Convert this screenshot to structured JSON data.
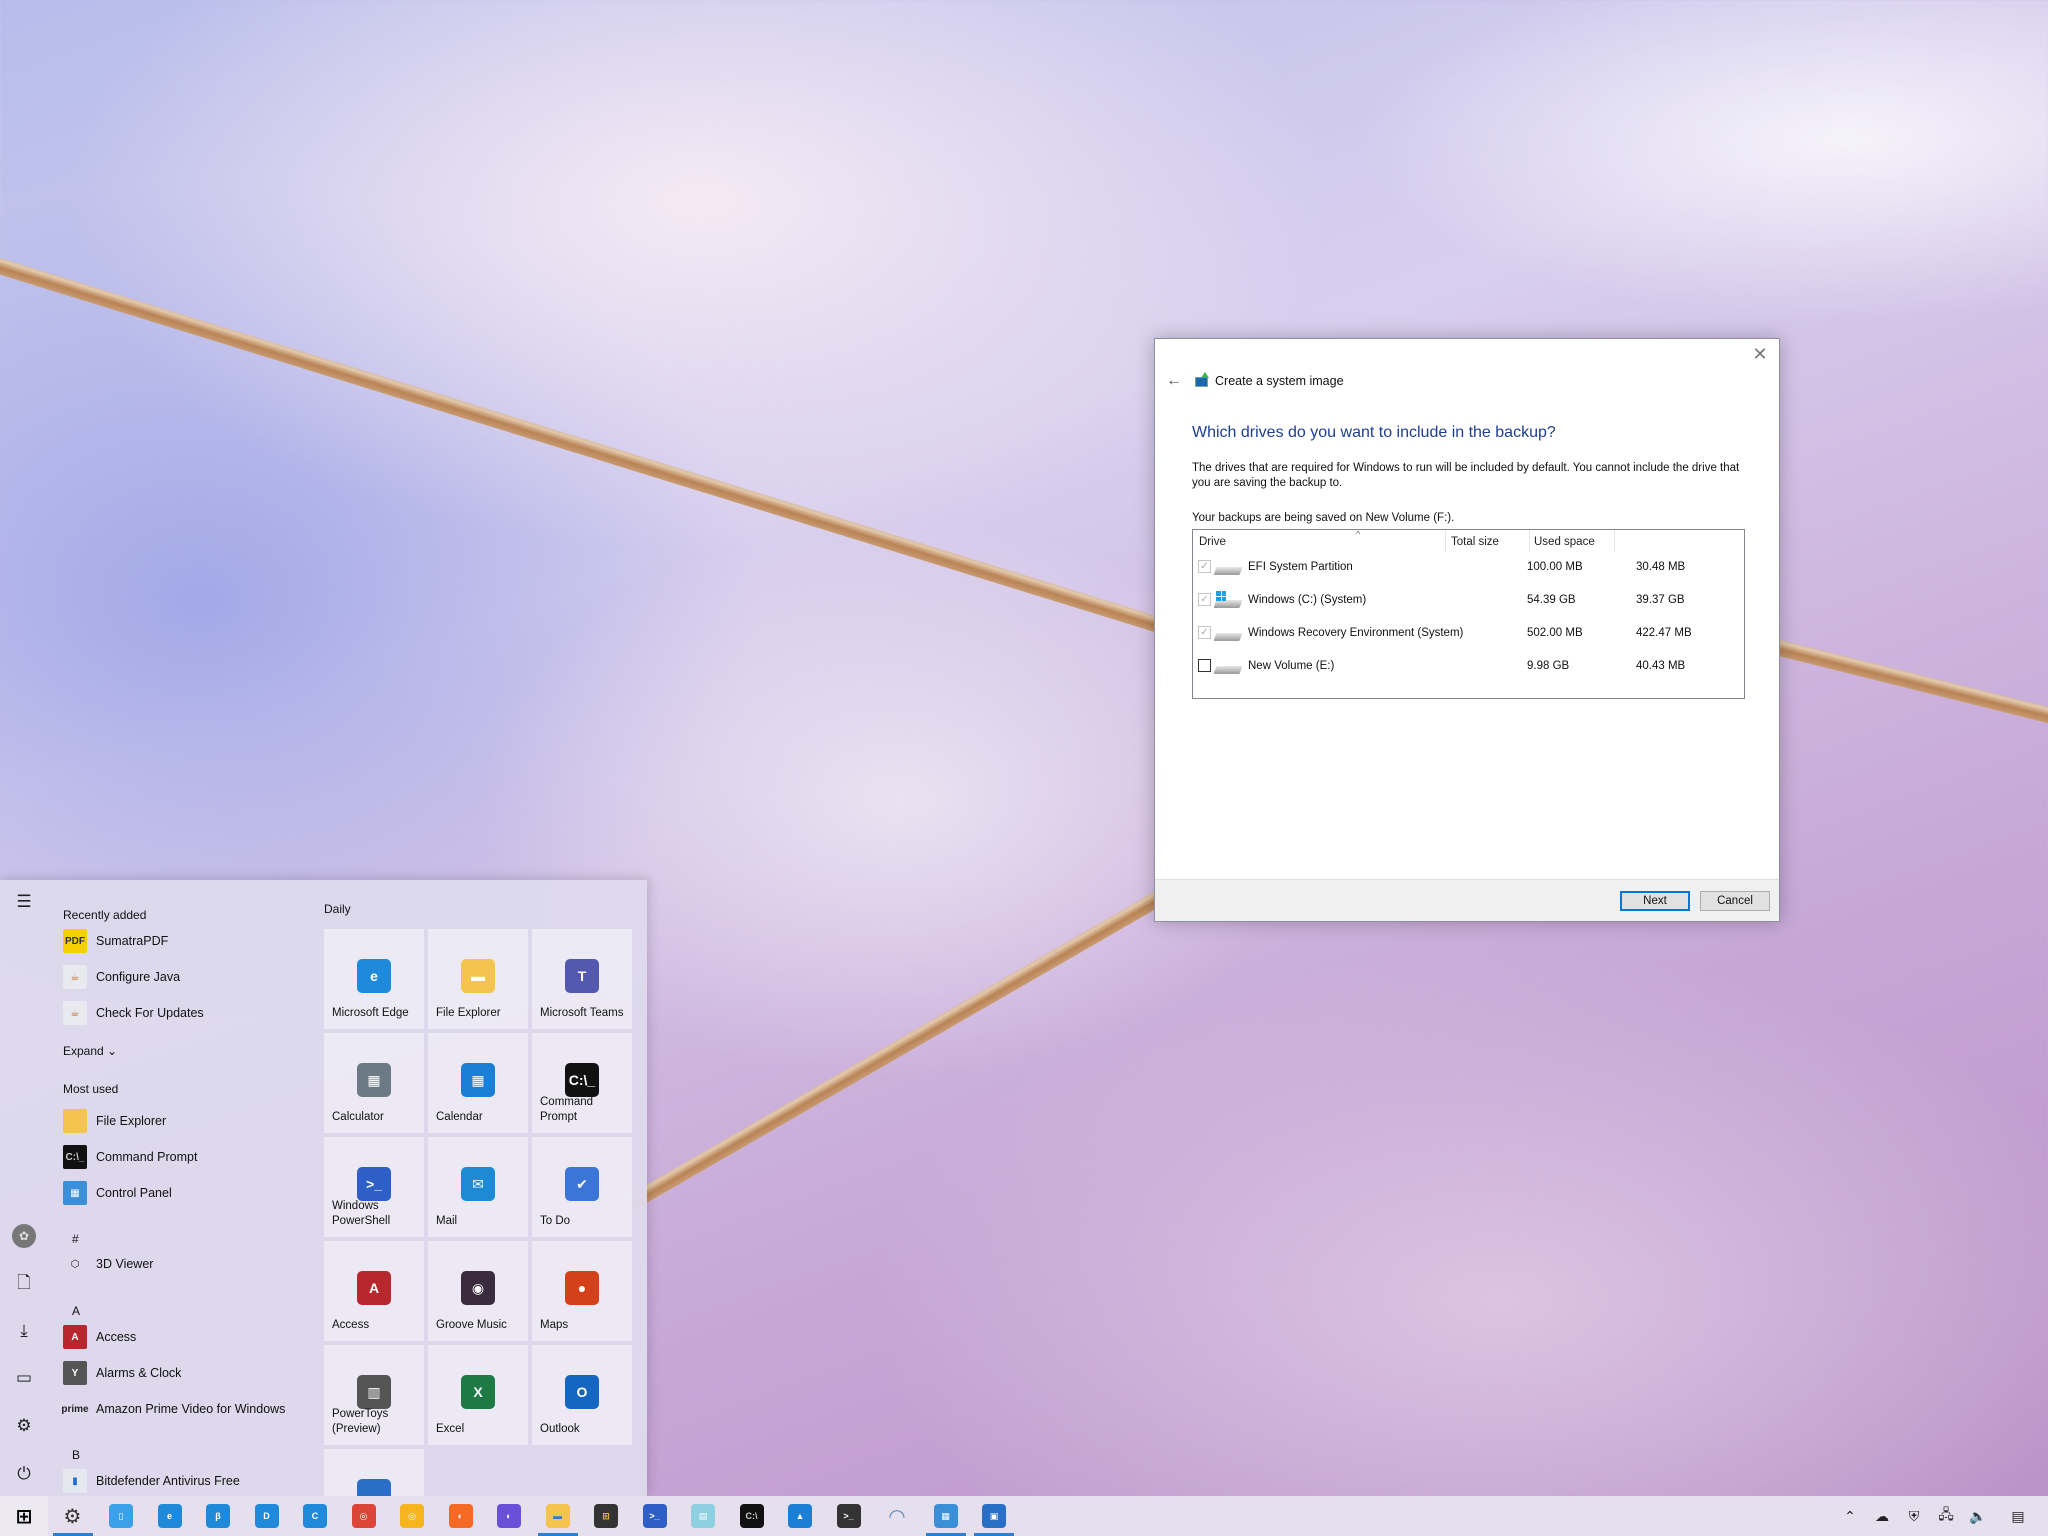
{
  "dialog": {
    "title": "Create a system image",
    "heading": "Which drives do you want to include in the backup?",
    "description": "The drives that are required for Windows to run will be included by default. You cannot include the drive that you are saving the backup to.",
    "saved_on": "Your backups are being saved on New Volume (F:).",
    "columns": [
      "Drive",
      "Total size",
      "Used space"
    ],
    "drives": [
      {
        "name": "EFI System Partition",
        "total": "100.00 MB",
        "used": "30.48 MB",
        "checked": true,
        "enabled": false,
        "icon": "drive-icon"
      },
      {
        "name": "Windows (C:) (System)",
        "total": "54.39 GB",
        "used": "39.37 GB",
        "checked": true,
        "enabled": false,
        "icon": "windows-drive-icon"
      },
      {
        "name": "Windows Recovery Environment (System)",
        "total": "502.00 MB",
        "used": "422.47 MB",
        "checked": true,
        "enabled": false,
        "icon": "drive-icon"
      },
      {
        "name": "New Volume (E:)",
        "total": "9.98 GB",
        "used": "40.43 MB",
        "checked": false,
        "enabled": true,
        "icon": "drive-icon"
      }
    ],
    "next_label": "Next",
    "cancel_label": "Cancel",
    "close_glyph": "✕",
    "back_glyph": "←"
  },
  "start_menu": {
    "recently_added_label": "Recently added",
    "recently_added": [
      {
        "label": "SumatraPDF",
        "icon": "sumatrapdf-icon",
        "glyph": "PDF",
        "color": "#f5d000",
        "fg": "#333"
      },
      {
        "label": "Configure Java",
        "icon": "java-icon",
        "glyph": "☕",
        "color": "#e8eaf0",
        "fg": "#c4641a"
      },
      {
        "label": "Check For Updates",
        "icon": "java-icon",
        "glyph": "☕",
        "color": "#e8eaf0",
        "fg": "#c4641a"
      }
    ],
    "expand_label": "Expand ⌄",
    "most_used_label": "Most used",
    "most_used": [
      {
        "label": "File Explorer",
        "icon": "file-explorer-icon",
        "glyph": "",
        "color": "#f4c44e",
        "fg": "#fff"
      },
      {
        "label": "Command Prompt",
        "icon": "command-prompt-icon",
        "glyph": "C:\\_",
        "color": "#111",
        "fg": "#ccc"
      },
      {
        "label": "Control Panel",
        "icon": "control-panel-icon",
        "glyph": "▦",
        "color": "#3b8fd9",
        "fg": "#fff"
      }
    ],
    "alpha_list": [
      {
        "letter": "#"
      },
      {
        "label": "3D Viewer",
        "icon": "3d-viewer-icon",
        "glyph": "⬡",
        "color": "transparent",
        "fg": "#222"
      },
      {
        "letter": "A"
      },
      {
        "label": "Access",
        "icon": "access-icon",
        "glyph": "A",
        "color": "#b7282e",
        "fg": "#fff"
      },
      {
        "label": "Alarms & Clock",
        "icon": "alarms-clock-icon",
        "glyph": "Y",
        "color": "#555",
        "fg": "#fff"
      },
      {
        "label": "Amazon Prime Video for Windows",
        "icon": "prime-video-icon",
        "glyph": "prime",
        "color": "transparent",
        "fg": "#222"
      },
      {
        "letter": "B"
      },
      {
        "label": "Bitdefender Antivirus Free",
        "icon": "bitdefender-icon",
        "glyph": "▮",
        "color": "#e6e8f0",
        "fg": "#1a6fd0"
      }
    ],
    "rail": [
      {
        "name": "hamburger-menu-icon",
        "glyph": "☰"
      },
      {
        "name": "user-avatar",
        "glyph": "✿"
      },
      {
        "name": "documents-icon",
        "glyph": "🗋"
      },
      {
        "name": "downloads-icon",
        "glyph": "⤓"
      },
      {
        "name": "pictures-icon",
        "glyph": "▭"
      },
      {
        "name": "settings-gear-icon",
        "glyph": "⚙"
      },
      {
        "name": "power-icon",
        "glyph": "⏻"
      }
    ],
    "tiles_group": "Daily",
    "tiles": [
      {
        "label": "Microsoft Edge",
        "icon": "edge-icon",
        "glyph": "e",
        "color": "#1f8ad9"
      },
      {
        "label": "File Explorer",
        "icon": "file-explorer-icon",
        "glyph": "▬",
        "color": "#f4c44e"
      },
      {
        "label": "Microsoft Teams",
        "icon": "teams-icon",
        "glyph": "T",
        "color": "#5558af"
      },
      {
        "label": "Calculator",
        "icon": "calculator-icon",
        "glyph": "▦",
        "color": "#6c7a86"
      },
      {
        "label": "Calendar",
        "icon": "calendar-icon",
        "glyph": "▦",
        "color": "#1c7fd6"
      },
      {
        "label": "Command Prompt",
        "icon": "command-prompt-icon",
        "glyph": "C:\\_",
        "color": "#111"
      },
      {
        "label": "Windows PowerShell",
        "icon": "powershell-icon",
        "glyph": ">_",
        "color": "#2d5fc7"
      },
      {
        "label": "Mail",
        "icon": "mail-icon",
        "glyph": "✉",
        "color": "#1e8ad6"
      },
      {
        "label": "To Do",
        "icon": "todo-icon",
        "glyph": "✔",
        "color": "#3a76d6"
      },
      {
        "label": "Access",
        "icon": "access-icon",
        "glyph": "A",
        "color": "#b7282e"
      },
      {
        "label": "Groove Music",
        "icon": "groove-music-icon",
        "glyph": "◉",
        "color": "#3a2c3e"
      },
      {
        "label": "Maps",
        "icon": "maps-icon",
        "glyph": "●",
        "color": "#d4401a"
      },
      {
        "label": "PowerToys (Preview)",
        "icon": "powertoys-icon",
        "glyph": "▥",
        "color": "#555"
      },
      {
        "label": "Excel",
        "icon": "excel-icon",
        "glyph": "X",
        "color": "#1d7a45"
      },
      {
        "label": "Outlook",
        "icon": "outlook-icon",
        "glyph": "O",
        "color": "#1466c0"
      },
      {
        "label": "",
        "icon": "partial-tile-icon",
        "glyph": "",
        "color": "#2a6fc7"
      }
    ]
  },
  "taskbar": {
    "items": [
      {
        "name": "start-button",
        "glyph": "⊞",
        "color": "transparent",
        "fg": "#000",
        "running": false
      },
      {
        "name": "settings-icon",
        "glyph": "⚙",
        "color": "transparent",
        "fg": "#333",
        "running": true
      },
      {
        "name": "phone-icon",
        "glyph": "▯",
        "color": "#3aa0e8",
        "fg": "#fff",
        "running": false
      },
      {
        "name": "edge-icon",
        "glyph": "e",
        "color": "#1f8ad9",
        "fg": "#fff",
        "running": false
      },
      {
        "name": "edge-beta-icon",
        "glyph": "β",
        "color": "#1f8ad9",
        "fg": "#fff",
        "running": false
      },
      {
        "name": "edge-dev-icon",
        "glyph": "D",
        "color": "#1f8ad9",
        "fg": "#fff",
        "running": false
      },
      {
        "name": "edge-canary-icon",
        "glyph": "C",
        "color": "#1f8ad9",
        "fg": "#fff",
        "running": false
      },
      {
        "name": "chrome-icon",
        "glyph": "◎",
        "color": "#db4437",
        "fg": "#fff",
        "running": false
      },
      {
        "name": "chrome-canary-icon",
        "glyph": "◎",
        "color": "#f6b41f",
        "fg": "#fff",
        "running": false
      },
      {
        "name": "firefox-icon",
        "glyph": "◐",
        "color": "#f46b25",
        "fg": "#fff",
        "running": false
      },
      {
        "name": "firefox-nightly-icon",
        "glyph": "◐",
        "color": "#6a4fd9",
        "fg": "#fff",
        "running": false
      },
      {
        "name": "file-explorer-icon",
        "glyph": "▬",
        "color": "#f4c44e",
        "fg": "#2a7fd0",
        "running": true
      },
      {
        "name": "store-icon",
        "glyph": "⊞",
        "color": "#333",
        "fg": "#f4c44e",
        "running": false
      },
      {
        "name": "powershell-icon",
        "glyph": ">_",
        "color": "#2d5fc7",
        "fg": "#fff",
        "running": false
      },
      {
        "name": "notepad-icon",
        "glyph": "▤",
        "color": "#8fd0e0",
        "fg": "#fff",
        "running": false
      },
      {
        "name": "command-prompt-icon",
        "glyph": "C:\\",
        "color": "#111",
        "fg": "#ccc",
        "running": false
      },
      {
        "name": "photos-icon",
        "glyph": "▲",
        "color": "#1c7fd6",
        "fg": "#fff",
        "running": false
      },
      {
        "name": "terminal-icon",
        "glyph": ">_",
        "color": "#333",
        "fg": "#fff",
        "running": false
      },
      {
        "name": "snip-icon",
        "glyph": "◠",
        "color": "transparent",
        "fg": "#5a8ac0",
        "running": false
      },
      {
        "name": "control-panel-icon",
        "glyph": "▦",
        "color": "#3b8fd9",
        "fg": "#fff",
        "running": true
      },
      {
        "name": "backup-restore-icon",
        "glyph": "▣",
        "color": "#2a6fc7",
        "fg": "#fff",
        "running": true
      }
    ],
    "tray": [
      {
        "name": "show-hidden-icons-chevron",
        "glyph": "⌃"
      },
      {
        "name": "onedrive-icon",
        "glyph": "☁"
      },
      {
        "name": "windows-security-icon",
        "glyph": "⛨"
      },
      {
        "name": "network-icon",
        "glyph": "🖧"
      },
      {
        "name": "volume-icon",
        "glyph": "🔈"
      },
      {
        "name": "action-center-icon",
        "glyph": "▤"
      }
    ]
  }
}
